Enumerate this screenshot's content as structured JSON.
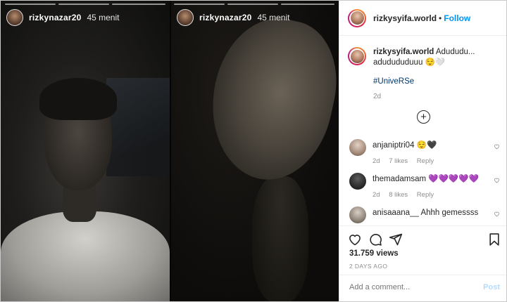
{
  "stories": [
    {
      "username": "rizkynazar20",
      "time": "45 menit"
    },
    {
      "username": "rizkynazar20",
      "time": "45 menit"
    }
  ],
  "post": {
    "username": "rizkysyifa.world",
    "separator": "•",
    "follow_label": "Follow",
    "caption_text": "Adududu... adudududuuu 😌🤍",
    "hashtag": "#UniveRSe",
    "age": "2d"
  },
  "comments": [
    {
      "username": "anjaniptri04",
      "text": "😌🖤",
      "age": "2d",
      "likes": "7 likes",
      "reply": "Reply"
    },
    {
      "username": "themadamsam",
      "text": "💜💜💜💜💜",
      "age": "2d",
      "likes": "8 likes",
      "reply": "Reply"
    },
    {
      "username": "anisaaana__",
      "text": "Ahhh gemessss"
    }
  ],
  "stats": {
    "views": "31.759 views",
    "date": "2 DAYS AGO"
  },
  "add_comment": {
    "placeholder": "Add a comment...",
    "post_label": "Post"
  },
  "colors": {
    "accent": "#0095f6",
    "text": "#262626",
    "muted": "#8e8e8e",
    "hashtag": "#00376b"
  }
}
